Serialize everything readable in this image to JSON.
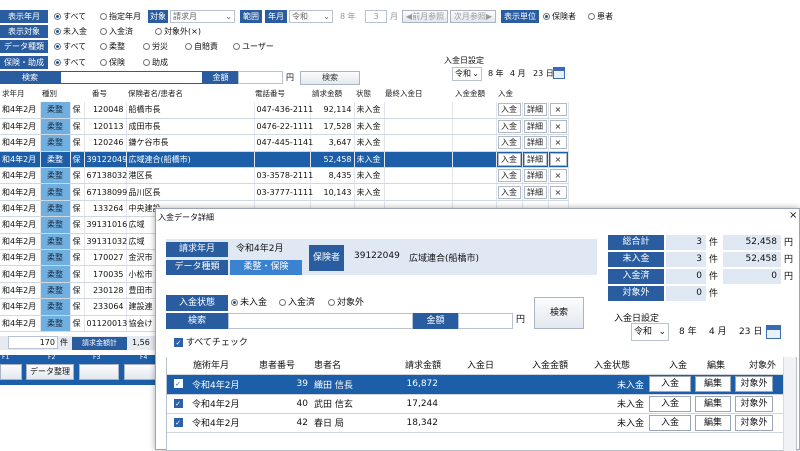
{
  "main": {
    "r1": {
      "label": "表示年月",
      "opt1": "すべて",
      "opt2": "指定年月",
      "taisho": "対象",
      "taisho_val": "請求月",
      "hanni": "範囲",
      "nen_label": "年月",
      "era": "令和",
      "year": "8",
      "nen": "年",
      "month": "3",
      "tsuki": "月",
      "prev": "◀前月参照",
      "next": "次月参照▶",
      "tani": "表示単位",
      "tani_opt1": "保険者",
      "tani_opt2": "患者"
    },
    "r2": {
      "label": "表示対象",
      "opt1": "未入金",
      "opt2": "入金済",
      "opt3": "対象外(×)"
    },
    "r3": {
      "label": "データ種類",
      "opt1": "すべて",
      "opt2": "柔整",
      "opt3": "労災",
      "opt4": "自賠責",
      "opt5": "ユーザー"
    },
    "r4": {
      "label": "保険・助成",
      "opt1": "すべて",
      "opt2": "保険",
      "opt3": "助成"
    },
    "r5": {
      "kensaku": "検索",
      "kingaku": "金額",
      "yen": "円",
      "search_btn": "検索"
    },
    "deposit_date": {
      "label": "入金日設定",
      "era": "令和",
      "year": "8",
      "nen": "年",
      "month": "4",
      "tsuki": "月",
      "day": "23",
      "hi": "日"
    },
    "columns": [
      "求年月",
      "種別",
      "",
      "番号",
      "保険者名/患者名",
      "電話番号",
      "請求金額",
      "状態",
      "最終入金日",
      "入金金額",
      "入金"
    ],
    "rows": [
      {
        "ym": "和4年2月",
        "kind": "柔整",
        "ins": "保",
        "no": "120048",
        "name": "船橋市長",
        "tel": "047-436-2111",
        "amt": "92,114",
        "status": "未入金"
      },
      {
        "ym": "和4年2月",
        "kind": "柔整",
        "ins": "保",
        "no": "120113",
        "name": "成田市長",
        "tel": "0476-22-1111",
        "amt": "17,528",
        "status": "未入金"
      },
      {
        "ym": "和4年2月",
        "kind": "柔整",
        "ins": "保",
        "no": "120246",
        "name": "鎌ケ谷市長",
        "tel": "047-445-1141",
        "amt": "3,647",
        "status": "未入金"
      },
      {
        "ym": "和4年2月",
        "kind": "柔整",
        "ins": "保",
        "no": "39122049",
        "name": "広域連合(船橋市)",
        "tel": "",
        "amt": "52,458",
        "status": "未入金"
      },
      {
        "ym": "和4年2月",
        "kind": "柔整",
        "ins": "保",
        "no": "67138032",
        "name": "港区長",
        "tel": "03-3578-2111",
        "amt": "8,435",
        "status": "未入金"
      },
      {
        "ym": "和4年2月",
        "kind": "柔整",
        "ins": "保",
        "no": "67138099",
        "name": "品川区長",
        "tel": "03-3777-1111",
        "amt": "10,143",
        "status": "未入金"
      },
      {
        "ym": "和4年2月",
        "kind": "柔整",
        "ins": "保",
        "no": "133264",
        "name": "中央建設",
        "tel": "",
        "amt": "",
        "status": ""
      },
      {
        "ym": "和4年2月",
        "kind": "柔整",
        "ins": "保",
        "no": "39131016",
        "name": "広域",
        "tel": "",
        "amt": "",
        "status": ""
      },
      {
        "ym": "和4年2月",
        "kind": "柔整",
        "ins": "保",
        "no": "39131032",
        "name": "広域",
        "tel": "",
        "amt": "",
        "status": ""
      },
      {
        "ym": "和4年2月",
        "kind": "柔整",
        "ins": "保",
        "no": "170027",
        "name": "金沢市",
        "tel": "",
        "amt": "",
        "status": ""
      },
      {
        "ym": "和4年2月",
        "kind": "柔整",
        "ins": "保",
        "no": "170035",
        "name": "小松市",
        "tel": "",
        "amt": "",
        "status": ""
      },
      {
        "ym": "和4年2月",
        "kind": "柔整",
        "ins": "保",
        "no": "230128",
        "name": "豊田市",
        "tel": "",
        "amt": "",
        "status": ""
      },
      {
        "ym": "和4年2月",
        "kind": "柔整",
        "ins": "保",
        "no": "233064",
        "name": "建設連",
        "tel": "",
        "amt": "",
        "status": ""
      },
      {
        "ym": "和4年2月",
        "kind": "柔整",
        "ins": "保",
        "no": "01120013",
        "name": "協会け",
        "tel": "",
        "amt": "",
        "status": ""
      }
    ],
    "row_btn": {
      "nyukin": "入金",
      "shosai": "詳細",
      "x": "×"
    },
    "footer": {
      "count": "170",
      "ken": "件",
      "total_label": "請求金額計",
      "total": "1,56"
    },
    "fkeys": {
      "f1": "F1",
      "f2": "F2",
      "f3": "F3",
      "f3_label": "データ整理",
      "f4": "F4"
    }
  },
  "dialog": {
    "title": "入金データ詳細",
    "close": "×",
    "seikyu_label": "請求年月",
    "seikyu_val": "令和4年2月",
    "shurui_label": "データ種類",
    "shurui_val": "柔整・保険",
    "hokensha_label": "保険者",
    "hokensha_no": "39122049",
    "hokensha_name": "広域連合(船橋市)",
    "summary": [
      {
        "label": "総合計",
        "count": "3",
        "ken": "件",
        "amount": "52,458",
        "yen": "円"
      },
      {
        "label": "未入金",
        "count": "3",
        "ken": "件",
        "amount": "52,458",
        "yen": "円"
      },
      {
        "label": "入金済",
        "count": "0",
        "ken": "件",
        "amount": "0",
        "yen": "円"
      },
      {
        "label": "対象外",
        "count": "0",
        "ken": "件"
      }
    ],
    "status_label": "入金状態",
    "st1": "未入金",
    "st2": "入金済",
    "st3": "対象外",
    "kensaku": "検索",
    "kingaku": "金額",
    "yen": "円",
    "search_btn": "検索",
    "date_label": "入金日設定",
    "era": "令和",
    "year": "8",
    "nen": "年",
    "month": "4",
    "tsuki": "月",
    "day": "23",
    "hi": "日",
    "check_all": "すべてチェック",
    "columns": [
      "",
      "施術年月",
      "患者番号",
      "患者名",
      "請求金額",
      "入金日",
      "入金金額",
      "入金状態",
      "入金",
      "編集",
      "対象外"
    ],
    "rows": [
      {
        "ym": "令和4年2月",
        "no": "39",
        "name": "織田 信長",
        "amt": "16,872",
        "status": "未入金"
      },
      {
        "ym": "令和4年2月",
        "no": "40",
        "name": "武田 信玄",
        "amt": "17,244",
        "status": "未入金"
      },
      {
        "ym": "令和4年2月",
        "no": "42",
        "name": "春日 局",
        "amt": "18,342",
        "status": "未入金"
      }
    ],
    "row_btn": {
      "nyukin": "入金",
      "henshu": "編集",
      "taishogai": "対象外"
    }
  }
}
